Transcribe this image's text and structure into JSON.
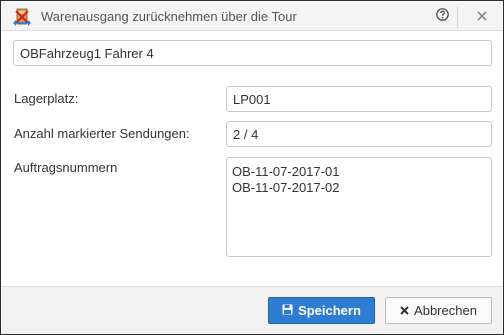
{
  "dialog": {
    "title": "Warenausgang zurücknehmen über die Tour",
    "help_icon": "help-circle-icon",
    "close_icon": "close-icon"
  },
  "form": {
    "tour_name": "OBFahrzeug1 Fahrer 4",
    "lagerplatz_label": "Lagerplatz:",
    "lagerplatz_value": "LP001",
    "anzahl_label": "Anzahl markierter Sendungen:",
    "anzahl_value": "2 / 4",
    "auftrag_label": "Auftragsnummern",
    "auftragsnummern": [
      "OB-11-07-2017-01",
      "OB-11-07-2017-02"
    ]
  },
  "buttons": {
    "save_label": "Speichern",
    "save_icon": "floppy-disk-icon",
    "cancel_label": "Abbrechen",
    "cancel_icon": "x-icon"
  },
  "colors": {
    "accent": "#2f7cd3",
    "titlebar": "#f4f4f4",
    "footer": "#f2f2f2"
  }
}
